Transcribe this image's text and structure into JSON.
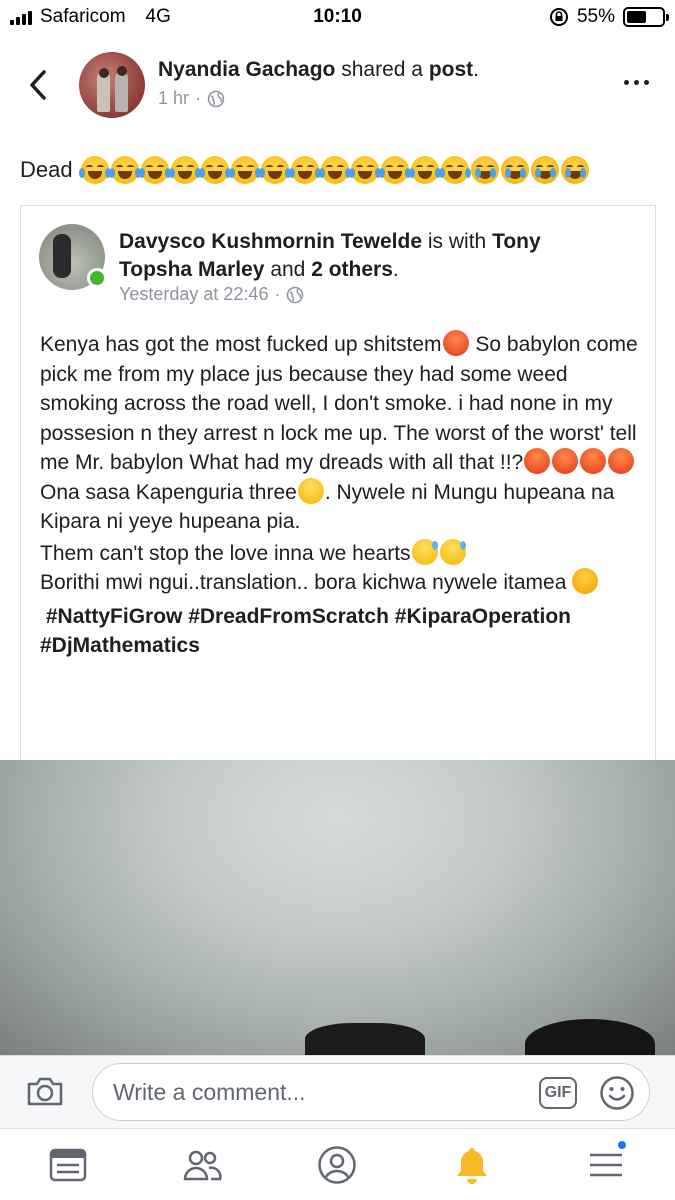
{
  "status_bar": {
    "carrier": "Safaricom",
    "network": "4G",
    "time": "10:10",
    "battery_percent": "55%",
    "battery_level": 0.55
  },
  "post": {
    "author": "Nyandia Gachago",
    "action": "shared a",
    "object": "post",
    "period": ".",
    "time_ago": "1 hr",
    "separator": "·",
    "privacy_icon": "globe-icon",
    "text": "Dead",
    "emojis": [
      "joy",
      "joy",
      "joy",
      "joy",
      "joy",
      "joy",
      "joy",
      "joy",
      "joy",
      "joy",
      "joy",
      "joy",
      "joy",
      "sob",
      "sob",
      "sob",
      "sob"
    ]
  },
  "shared": {
    "author": "Davysco Kushmornin Tewelde",
    "with_text": "is with",
    "tagged": "Tony Topsha Marley",
    "and_text": "and",
    "others": "2 others",
    "period": ".",
    "timestamp": "Yesterday at 22:46",
    "separator": "·",
    "online": true,
    "body": {
      "p1a": "Kenya has got the most fucked up shitstem",
      "p1b": " So babylon come pick me from my place jus because they had some weed smoking across the road well, I don't smoke. i had none in my possesion n they arrest n lock me up. The worst of the worst' tell me Mr. babylon What had my dreads with all that !!?",
      "p1c": " Ona sasa Kapenguria three",
      "p1d": ". Nywele ni Mungu hupeana na Kipara ni yeye hupeana pia.",
      "p2": "Them can't stop the love inna we hearts",
      "p3": "Borithi mwi ngui..translation.. bora kichwa nywele itamea",
      "tags": "#NattyFiGrow #DreadFromScratch #KiparaOperation #DjMathematics"
    }
  },
  "comment_bar": {
    "placeholder": "Write a comment...",
    "gif_label": "GIF"
  },
  "tab_bar": {
    "tabs": [
      "news-feed-icon",
      "friends-icon",
      "profile-icon",
      "notifications-icon",
      "menu-icon"
    ],
    "accent": "#1877f2",
    "active_color": "#f7b928"
  }
}
